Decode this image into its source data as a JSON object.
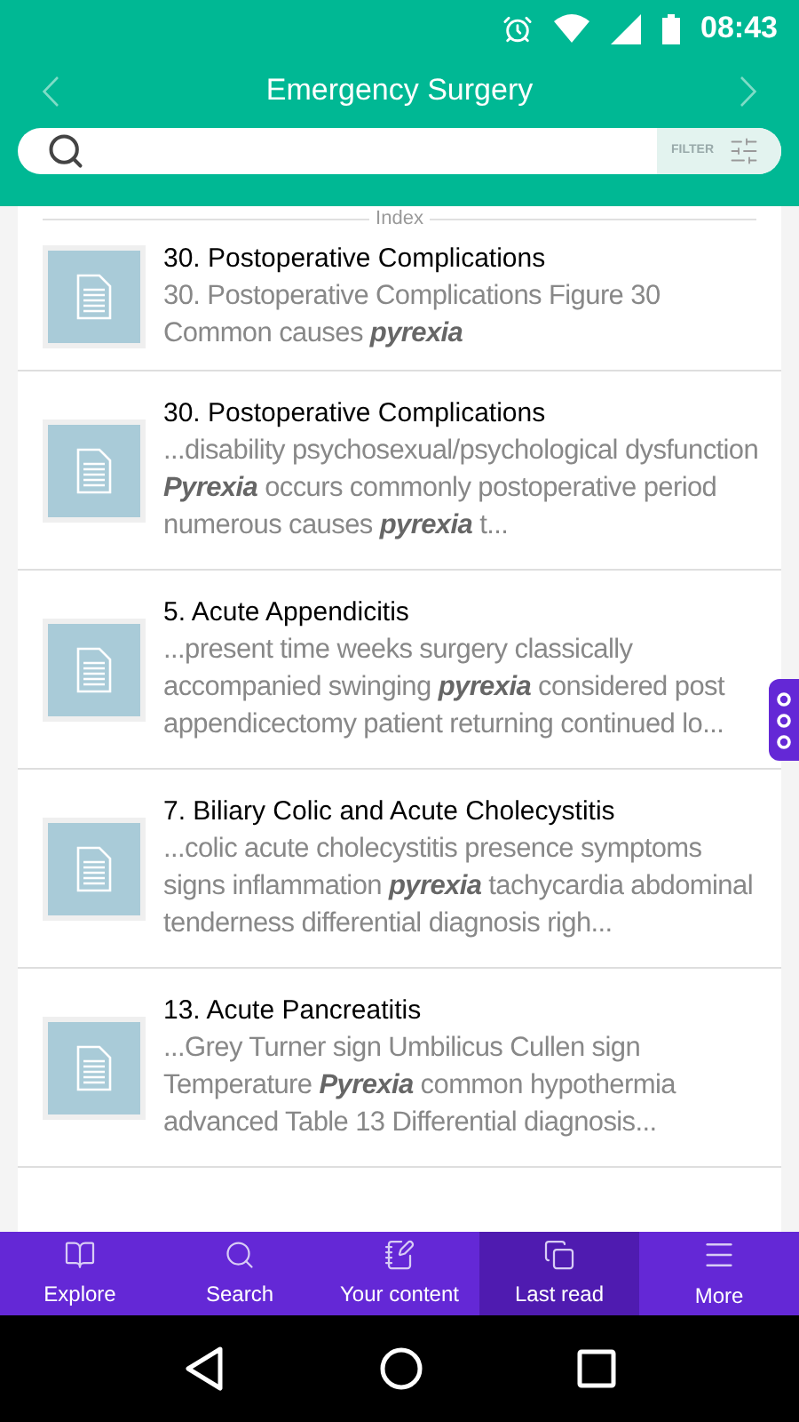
{
  "status_bar": {
    "time": "08:43"
  },
  "header": {
    "title": "Emergency Surgery"
  },
  "search": {
    "filter_label": "FILTER"
  },
  "section_label": "Index",
  "results": [
    {
      "title": "30. Postoperative Complications",
      "snippet": "30. Postoperative Complications Figure 30 Common causes *pyrexia*"
    },
    {
      "title": "30. Postoperative Complications",
      "snippet": "...disability psychosexual/psychological dysfunction *Pyrexia* occurs commonly postoperative period numerous causes *pyrexia* t..."
    },
    {
      "title": "5. Acute Appendicitis",
      "snippet": "...present time weeks surgery classically accompanied swinging *pyrexia* considered post appendicectomy patient returning continued lo..."
    },
    {
      "title": "7. Biliary Colic and Acute Cholecystitis",
      "snippet": "...colic acute cholecystitis presence symptoms signs inflammation *pyrexia* tachycardia abdominal tenderness differential diagnosis righ..."
    },
    {
      "title": "13. Acute Pancreatitis",
      "snippet": "...Grey Turner sign Umbilicus Cullen sign Temperature *Pyrexia* common hypothermia advanced Table 13 Differential diagnosis..."
    }
  ],
  "bottom_nav": [
    {
      "kind": "explore",
      "label": "Explore",
      "selected": false
    },
    {
      "kind": "search",
      "label": "Search",
      "selected": false
    },
    {
      "kind": "content",
      "label": "Your content",
      "selected": false
    },
    {
      "kind": "lastread",
      "label": "Last read",
      "selected": true
    },
    {
      "kind": "more",
      "label": "More",
      "selected": false
    }
  ]
}
